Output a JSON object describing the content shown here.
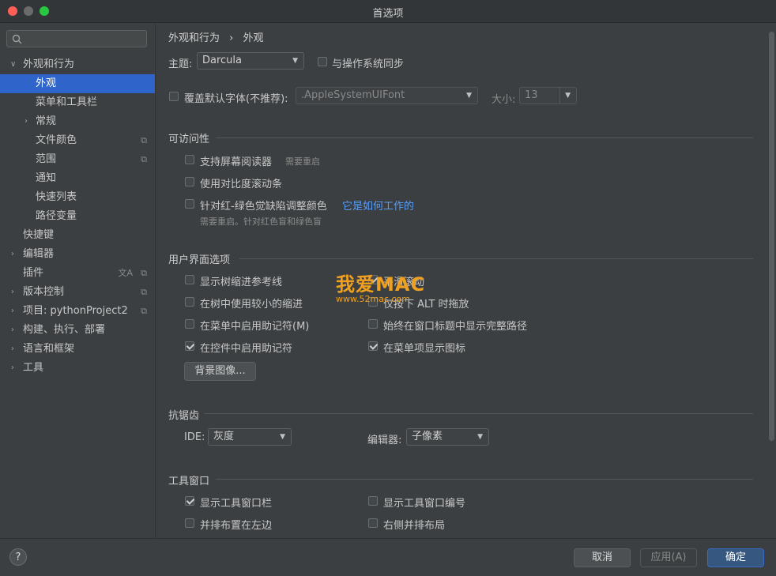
{
  "window": {
    "title": "首选项"
  },
  "sidebar": {
    "search_placeholder": "",
    "items": [
      {
        "label": "外观和行为",
        "arrow": "∨"
      },
      {
        "label": "外观"
      },
      {
        "label": "菜单和工具栏"
      },
      {
        "label": "常规",
        "arrow": "›"
      },
      {
        "label": "文件颜色"
      },
      {
        "label": "范围"
      },
      {
        "label": "通知"
      },
      {
        "label": "快速列表"
      },
      {
        "label": "路径变量"
      },
      {
        "label": "快捷键"
      },
      {
        "label": "编辑器",
        "arrow": "›"
      },
      {
        "label": "插件"
      },
      {
        "label": "版本控制",
        "arrow": "›"
      },
      {
        "label": "项目: pythonProject2",
        "arrow": "›"
      },
      {
        "label": "构建、执行、部署",
        "arrow": "›"
      },
      {
        "label": "语言和框架",
        "arrow": "›"
      },
      {
        "label": "工具",
        "arrow": "›"
      }
    ]
  },
  "breadcrumb": {
    "parent": "外观和行为",
    "sep": "›",
    "current": "外观"
  },
  "theme": {
    "label": "主题:",
    "value": "Darcula",
    "sync_label": "与操作系统同步"
  },
  "font": {
    "override_label": "覆盖默认字体(不推荐):",
    "value": ".AppleSystemUIFont",
    "size_label": "大小:",
    "size_value": "13"
  },
  "accessibility": {
    "title": "可访问性",
    "screen_reader": "支持屏幕阅读器",
    "screen_reader_hint": "需要重启",
    "contrast_scroll": "使用对比度滚动条",
    "color_adjust": "针对红-绿色觉缺陷调整颜色",
    "color_adjust_link": "它是如何工作的",
    "color_adjust_hint": "需要重启。针对红色盲和绿色盲"
  },
  "ui_options": {
    "title": "用户界面选项",
    "left": [
      "显示树缩进参考线",
      "在树中使用较小的缩进",
      "在菜单中启用助记符(M)",
      "在控件中启用助记符"
    ],
    "right": [
      "平滑滚动",
      "仅按下 ALT 时拖放",
      "始终在窗口标题中显示完整路径",
      "在菜单项显示图标"
    ],
    "bg_button": "背景图像..."
  },
  "antialias": {
    "title": "抗锯齿",
    "ide_label": "IDE:",
    "ide_value": "灰度",
    "editor_label": "编辑器:",
    "editor_value": "子像素"
  },
  "tool_windows": {
    "title": "工具窗口",
    "left": [
      "显示工具窗口栏",
      "并排布置在左边"
    ],
    "right": [
      "显示工具窗口编号",
      "右侧并排布局"
    ]
  },
  "watermark": {
    "brand": "我爱MAC",
    "url": "www.52mac.com"
  },
  "footer": {
    "help": "?",
    "cancel": "取消",
    "apply": "应用(A)",
    "ok": "确定"
  }
}
